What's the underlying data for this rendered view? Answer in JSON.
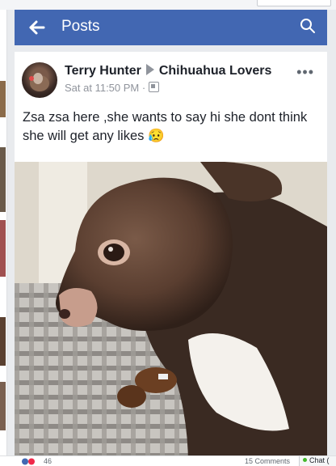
{
  "appbar": {
    "title": "Posts",
    "back_icon": "back-arrow-icon",
    "search_icon": "search-icon"
  },
  "post": {
    "author": "Terry Hunter",
    "group": "Chihuahua Lovers",
    "time": "Sat at 11:50 PM",
    "separator": "·",
    "text": "Zsa zsa here ,she wants to say hi she dont think she will get any  likes 😥",
    "photo": "chihuahua-photo"
  },
  "footer": {
    "reactions": "46",
    "comments": "15 Comments",
    "chat": "Chat ("
  },
  "colors": {
    "brand": "#4267b2",
    "background": "#e9ebee",
    "text": "#1d2129",
    "meta": "#90949c"
  }
}
